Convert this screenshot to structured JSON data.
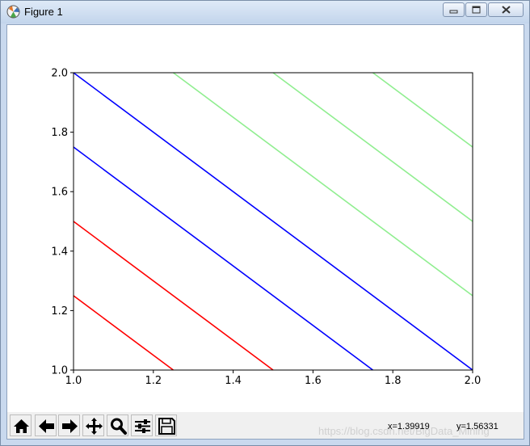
{
  "window": {
    "title": "Figure 1"
  },
  "toolbar": {
    "buttons": [
      {
        "name": "home",
        "icon": "home-icon"
      },
      {
        "name": "back",
        "icon": "back-arrow-icon"
      },
      {
        "name": "forward",
        "icon": "forward-arrow-icon"
      },
      {
        "name": "pan",
        "icon": "move-icon"
      },
      {
        "name": "zoom",
        "icon": "zoom-icon"
      },
      {
        "name": "configure-subplots",
        "icon": "sliders-icon"
      },
      {
        "name": "save",
        "icon": "save-icon"
      }
    ],
    "coords": {
      "x": "x=1.39919",
      "y": "y=1.56331"
    },
    "watermark": "https://blog.csdn.net/BigData_Mining"
  },
  "chart_data": {
    "type": "line",
    "xlim": [
      1.0,
      2.0
    ],
    "ylim": [
      1.0,
      2.0
    ],
    "xticks": [
      "1.0",
      "1.2",
      "1.4",
      "1.6",
      "1.8",
      "2.0"
    ],
    "yticks": [
      "1.0",
      "1.2",
      "1.4",
      "1.6",
      "1.8",
      "2.0"
    ],
    "grid": false,
    "series": [
      {
        "color": "#ff0000",
        "x": [
          1.0,
          1.25
        ],
        "y": [
          1.25,
          1.0
        ]
      },
      {
        "color": "#ff0000",
        "x": [
          1.0,
          1.5
        ],
        "y": [
          1.5,
          1.0
        ]
      },
      {
        "color": "#0000ff",
        "x": [
          1.0,
          1.75
        ],
        "y": [
          1.75,
          1.0
        ]
      },
      {
        "color": "#0000ff",
        "x": [
          1.0,
          2.0
        ],
        "y": [
          2.0,
          1.0
        ]
      },
      {
        "color": "#90ee90",
        "x": [
          1.25,
          2.0
        ],
        "y": [
          2.0,
          1.25
        ]
      },
      {
        "color": "#90ee90",
        "x": [
          1.5,
          2.0
        ],
        "y": [
          2.0,
          1.5
        ]
      },
      {
        "color": "#90ee90",
        "x": [
          1.75,
          2.0
        ],
        "y": [
          2.0,
          1.75
        ]
      }
    ]
  }
}
